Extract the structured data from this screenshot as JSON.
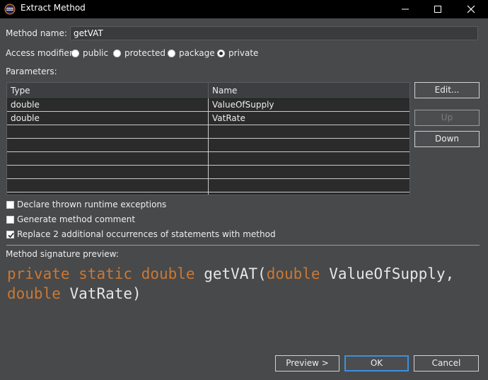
{
  "window": {
    "title": "Extract Method",
    "controls": [
      "minimize-icon",
      "maximize-icon",
      "close-icon"
    ]
  },
  "method_name": {
    "label": "Method name:",
    "value": "getVAT"
  },
  "access_modifier": {
    "label": "Access modifier:",
    "options": [
      {
        "label": "public",
        "selected": false
      },
      {
        "label": "protected",
        "selected": false
      },
      {
        "label": "package",
        "selected": false
      },
      {
        "label": "private",
        "selected": true
      }
    ]
  },
  "parameters": {
    "label": "Parameters:",
    "columns": [
      "Type",
      "Name"
    ],
    "rows": [
      {
        "type": "double",
        "name": "ValueOfSupply"
      },
      {
        "type": "double",
        "name": "VatRate"
      }
    ],
    "buttons": {
      "edit": "Edit...",
      "up": "Up",
      "down": "Down"
    }
  },
  "options": [
    {
      "label": "Declare thrown runtime exceptions",
      "checked": false
    },
    {
      "label": "Generate method comment",
      "checked": false
    },
    {
      "label": "Replace 2 additional occurrences of statements with method",
      "checked": true
    }
  ],
  "signature": {
    "label": "Method signature preview:",
    "kw_private": "private",
    "kw_static": "static",
    "kw_return": "double",
    "method": "getVAT(",
    "p1_type": "double",
    "p1_name": "ValueOfSupply,",
    "p2_type": "double",
    "p2_name": "VatRate)"
  },
  "footer": {
    "preview": "Preview >",
    "ok": "OK",
    "cancel": "Cancel"
  },
  "colors": {
    "background": "#47494b",
    "keyword": "#cc7832",
    "default_button_border": "#3d8ee0"
  }
}
